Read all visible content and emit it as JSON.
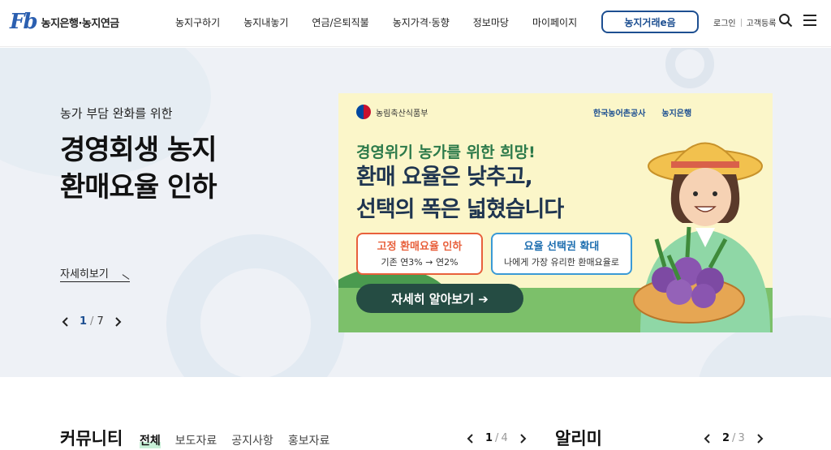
{
  "header": {
    "logo_mark": "Fb",
    "logo_text": "농지은행·농지연금",
    "nav": [
      "농지구하기",
      "농지내놓기",
      "연금/은퇴직불",
      "농지가격·동향",
      "정보마당",
      "마이페이지"
    ],
    "trade_button": "농지거래e음",
    "login": "로그인",
    "register": "고객등록"
  },
  "hero": {
    "subtitle": "농가 부담 완화를 위한",
    "title_line1": "경영회생 농지",
    "title_line2": "환매요율 인하",
    "more": "자세히보기",
    "page_current": "1",
    "page_total": "7"
  },
  "banner": {
    "ministry": "농림축산식품부",
    "partner1": "한국농어촌공사",
    "partner2": "농지은행",
    "headline": "경영위기 농가를 위한 희망!",
    "main_line1": "환매 요율은 낮추고,",
    "main_line2": "선택의 폭은 넓혔습니다",
    "box1_title": "고정 환매요율 인하",
    "box1_sub": "기존 연3% → 연2%",
    "box2_title": "요율 선택권 확대",
    "box2_sub": "나에게 가장 유리한 환매요율로",
    "cta": "자세히 알아보기 ➔"
  },
  "community": {
    "title": "커뮤니티",
    "tabs": [
      "전체",
      "보도자료",
      "공지사항",
      "홍보자료"
    ],
    "page_current": "1",
    "page_total": "4"
  },
  "alimi": {
    "title": "알리미",
    "page_current": "2",
    "page_total": "3"
  },
  "colors": {
    "brand_blue": "#1d4f91",
    "brand_red": "#e2322f",
    "hero_bg": "#eef1f6",
    "banner_bg": "#fbf6c9"
  }
}
